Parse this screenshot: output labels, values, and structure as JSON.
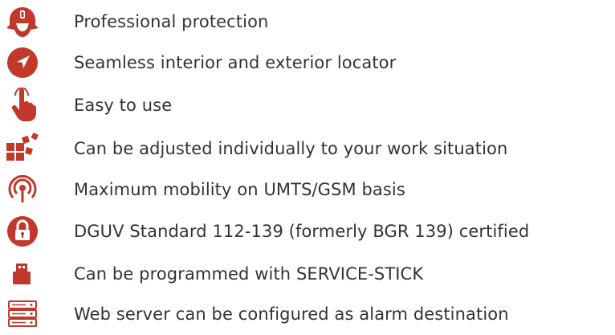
{
  "colors": {
    "accent": "#c0392b",
    "text": "#333333"
  },
  "features": [
    {
      "label": "Professional protection",
      "icon": "firefighter-helmet-icon"
    },
    {
      "label": "Seamless interior and exterior locator",
      "icon": "location-arrow-icon"
    },
    {
      "label": "Easy to use",
      "icon": "pointing-hand-icon"
    },
    {
      "label": "Can be adjusted individually to your work situation",
      "icon": "puzzle-blocks-icon"
    },
    {
      "label": "Maximum mobility on UMTS/GSM basis",
      "icon": "wireless-signal-icon"
    },
    {
      "label": "DGUV Standard 112-139 (formerly BGR 139) certified",
      "icon": "padlock-icon"
    },
    {
      "label": "Can be programmed with SERVICE-STICK",
      "icon": "usb-stick-icon"
    },
    {
      "label": "Web server can be configured as alarm destination",
      "icon": "server-rack-icon"
    }
  ]
}
